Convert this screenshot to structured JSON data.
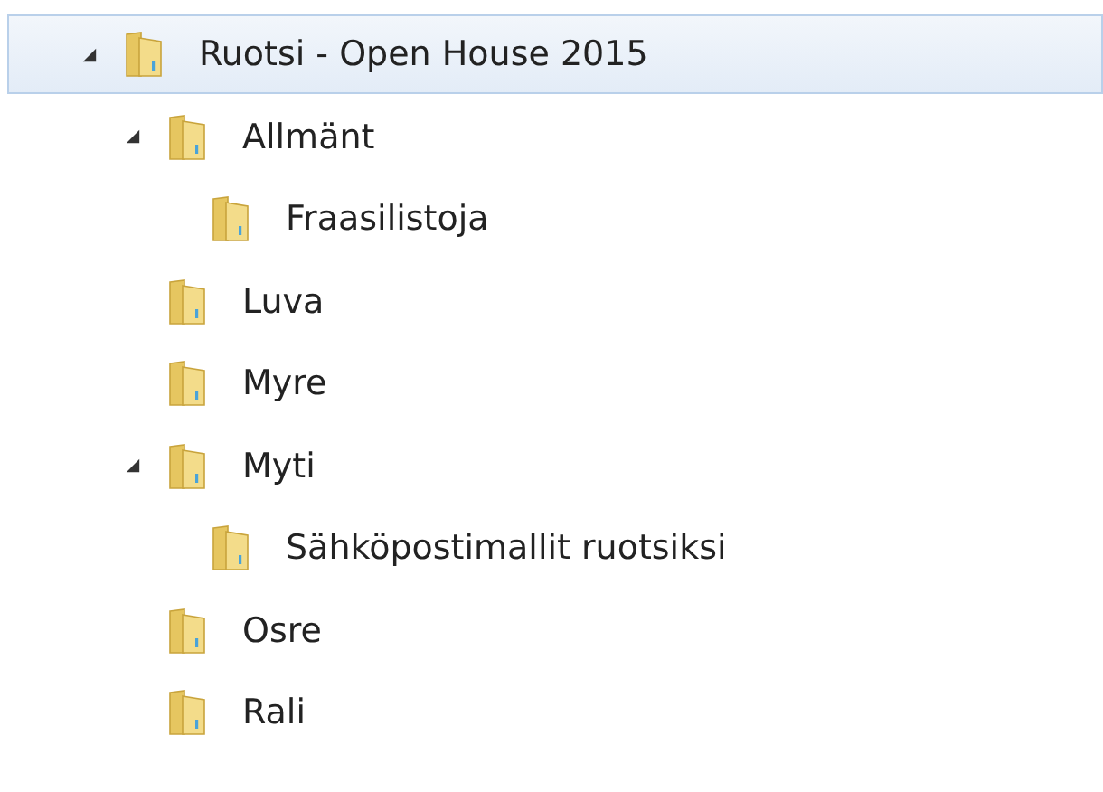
{
  "tree": [
    {
      "label": "Ruotsi - Open House 2015",
      "selected": true,
      "expanded": true,
      "children": [
        {
          "label": "Allmänt",
          "selected": false,
          "expanded": true,
          "children": [
            {
              "label": "Fraasilistoja",
              "selected": false
            }
          ]
        },
        {
          "label": "Luva",
          "selected": false
        },
        {
          "label": "Myre",
          "selected": false
        },
        {
          "label": "Myti",
          "selected": false,
          "expanded": true,
          "children": [
            {
              "label": "Sähköpostimallit ruotsiksi",
              "selected": false
            }
          ]
        },
        {
          "label": "Osre",
          "selected": false
        },
        {
          "label": "Rali",
          "selected": false
        }
      ]
    }
  ]
}
